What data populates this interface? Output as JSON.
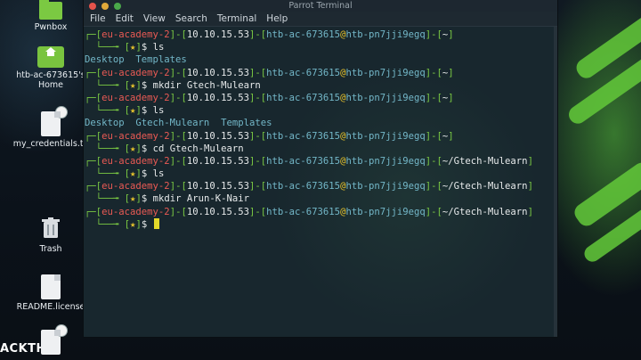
{
  "window": {
    "title": "Parrot Terminal",
    "traffic_lights": {
      "close": "#e5534b",
      "minimize": "#e0a83a",
      "maximize": "#4aa84a"
    },
    "menu": [
      "File",
      "Edit",
      "View",
      "Search",
      "Terminal",
      "Help"
    ]
  },
  "desktop": {
    "brand_text": "ACKTHE",
    "icons": [
      {
        "name": "pwnbox",
        "label": "Pwnbox",
        "kind": "folder"
      },
      {
        "name": "home",
        "label": "htb-ac-673615's Home",
        "kind": "home-folder"
      },
      {
        "name": "credentials",
        "label": "my_credentials.tx",
        "kind": "document"
      },
      {
        "name": "trash",
        "label": "Trash",
        "kind": "trash"
      },
      {
        "name": "readme",
        "label": "README.license",
        "kind": "document"
      },
      {
        "name": "file",
        "label": "",
        "kind": "document"
      }
    ]
  },
  "terminal": {
    "prompt": {
      "open": "[",
      "user": "eu-academy-2",
      "sep": "]-[",
      "ip": "10.10.15.53",
      "host_user": "htb-ac-673615",
      "at": "@",
      "host": "htb-pn7jji9egq",
      "dash": "]-[",
      "prefix_corner": "┌─",
      "prompt_corner": "└──╼ ",
      "prompt_star": "[★]",
      "prompt_symbol": "$ "
    },
    "lines": [
      {
        "type": "prompt",
        "cwd": "~"
      },
      {
        "type": "cmd",
        "text": "ls"
      },
      {
        "type": "output",
        "text": "Desktop  Templates"
      },
      {
        "type": "prompt",
        "cwd": "~"
      },
      {
        "type": "cmd",
        "text": "mkdir Gtech-Mulearn"
      },
      {
        "type": "prompt",
        "cwd": "~"
      },
      {
        "type": "cmd",
        "text": "ls"
      },
      {
        "type": "output",
        "text": "Desktop  Gtech-Mulearn  Templates"
      },
      {
        "type": "prompt",
        "cwd": "~"
      },
      {
        "type": "cmd",
        "text": "cd Gtech-Mulearn"
      },
      {
        "type": "prompt",
        "cwd": "~/Gtech-Mulearn"
      },
      {
        "type": "cmd",
        "text": "ls"
      },
      {
        "type": "prompt",
        "cwd": "~/Gtech-Mulearn"
      },
      {
        "type": "cmd",
        "text": "mkdir Arun-K-Nair"
      },
      {
        "type": "prompt",
        "cwd": "~/Gtech-Mulearn"
      },
      {
        "type": "cmd",
        "text": ""
      }
    ]
  }
}
